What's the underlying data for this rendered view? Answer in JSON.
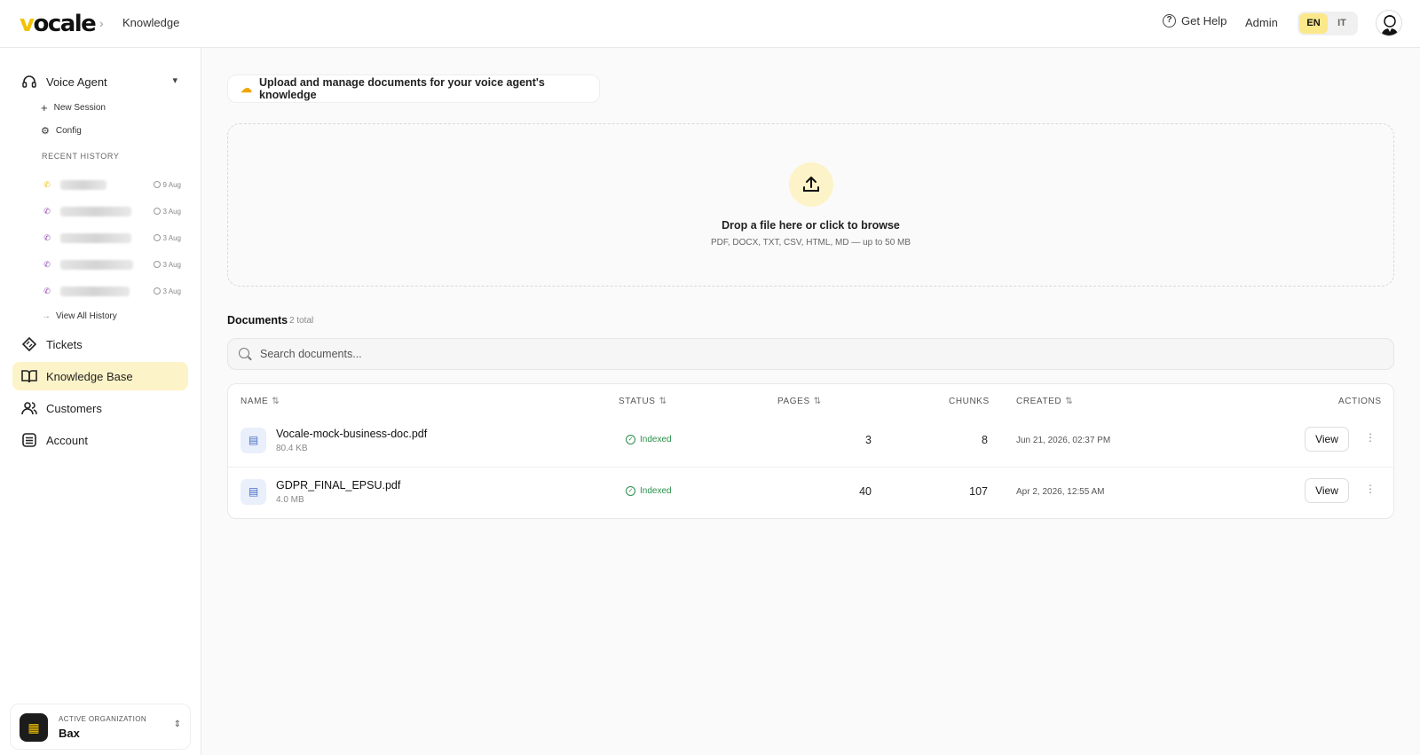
{
  "header": {
    "logo": "vocale",
    "breadcrumb": "Knowledge",
    "get_help": "Get Help",
    "admin": "Admin",
    "languages": [
      "EN",
      "IT"
    ],
    "active_language": "EN"
  },
  "sidebar": {
    "voice_agent": "Voice Agent",
    "new_session": "New Session",
    "config": "Config",
    "recent_history_label": "RECENT HISTORY",
    "history": [
      {
        "date": "9 Aug"
      },
      {
        "date": "3 Aug"
      },
      {
        "date": "3 Aug"
      },
      {
        "date": "3 Aug"
      },
      {
        "date": "3 Aug"
      }
    ],
    "view_all_history": "View All History",
    "items": [
      "Tickets",
      "Knowledge Base",
      "Customers",
      "Account"
    ],
    "active_item": "Knowledge Base",
    "org_label": "ACTIVE ORGANIZATION",
    "org_name": "Bax"
  },
  "main": {
    "intro": "Upload and manage documents for your voice agent's knowledge",
    "drop_title": "Drop a file here or click to browse",
    "drop_hint": "PDF, DOCX, TXT, CSV, HTML, MD — up to 50 MB",
    "documents_title": "Documents",
    "documents_count": "2 total",
    "search_placeholder": "Search documents...",
    "columns": {
      "name": "NAME",
      "status": "STATUS",
      "pages": "PAGES",
      "chunks": "CHUNKS",
      "created": "CREATED",
      "actions": "ACTIONS"
    },
    "rows": [
      {
        "name": "Vocale-mock-business-doc.pdf",
        "size": "80.4 KB",
        "status": "Indexed",
        "pages": "3",
        "chunks": "8",
        "created": "Jun 21, 2026, 02:37 PM",
        "action": "View"
      },
      {
        "name": "GDPR_FINAL_EPSU.pdf",
        "size": "4.0 MB",
        "status": "Indexed",
        "pages": "40",
        "chunks": "107",
        "created": "Apr 2, 2026, 12:55 AM",
        "action": "View"
      }
    ]
  },
  "colors": {
    "accent": "#f2c200",
    "active_nav_bg": "#fdf3c8",
    "status_green": "#2a8f4a",
    "call_icon_purple": "#8e44ad"
  }
}
